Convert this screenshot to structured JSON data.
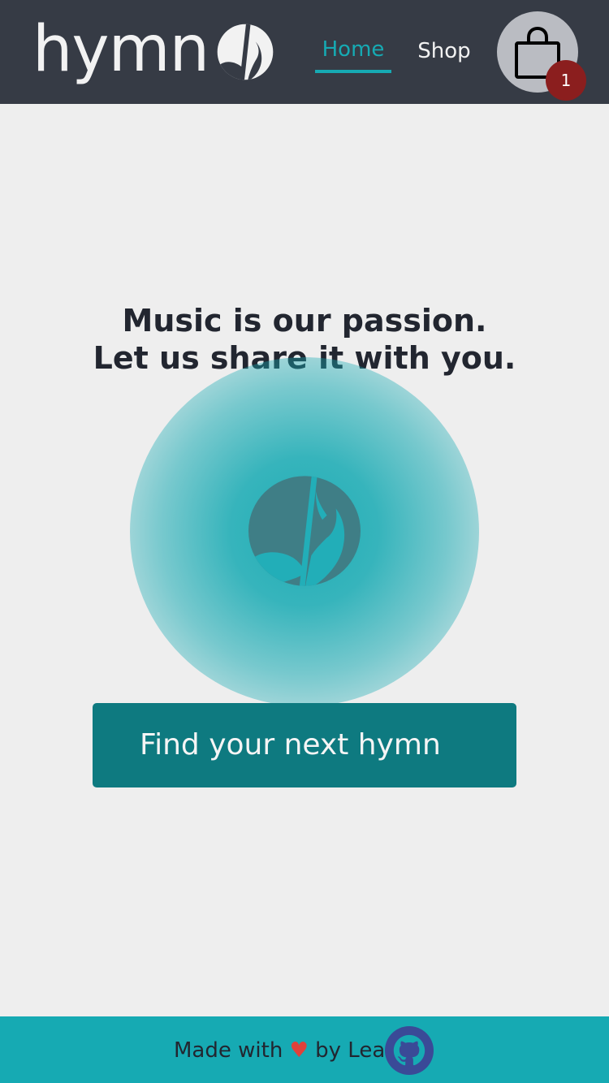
{
  "header": {
    "brand": "hymn",
    "nav": [
      {
        "label": "Home",
        "active": true
      },
      {
        "label": "Shop",
        "active": false
      }
    ],
    "cart": {
      "count": "1",
      "icon": "shopping-bag-icon"
    }
  },
  "hero": {
    "heading_line1": "Music is our passion.",
    "heading_line2": "Let us share it with you.",
    "logo_icon": "music-note-logo-icon",
    "cta_label": "Find your next hymn"
  },
  "footer": {
    "made_with": "Made with",
    "heart": "♥",
    "by": "by Leau",
    "github_icon": "github-icon"
  },
  "colors": {
    "header_bg": "#363b45",
    "accent": "#16aab3",
    "cta_bg": "#0e7a80",
    "badge": "#8b1e1e",
    "page_bg": "#eeeeee",
    "github_bg": "#3a4a97"
  }
}
